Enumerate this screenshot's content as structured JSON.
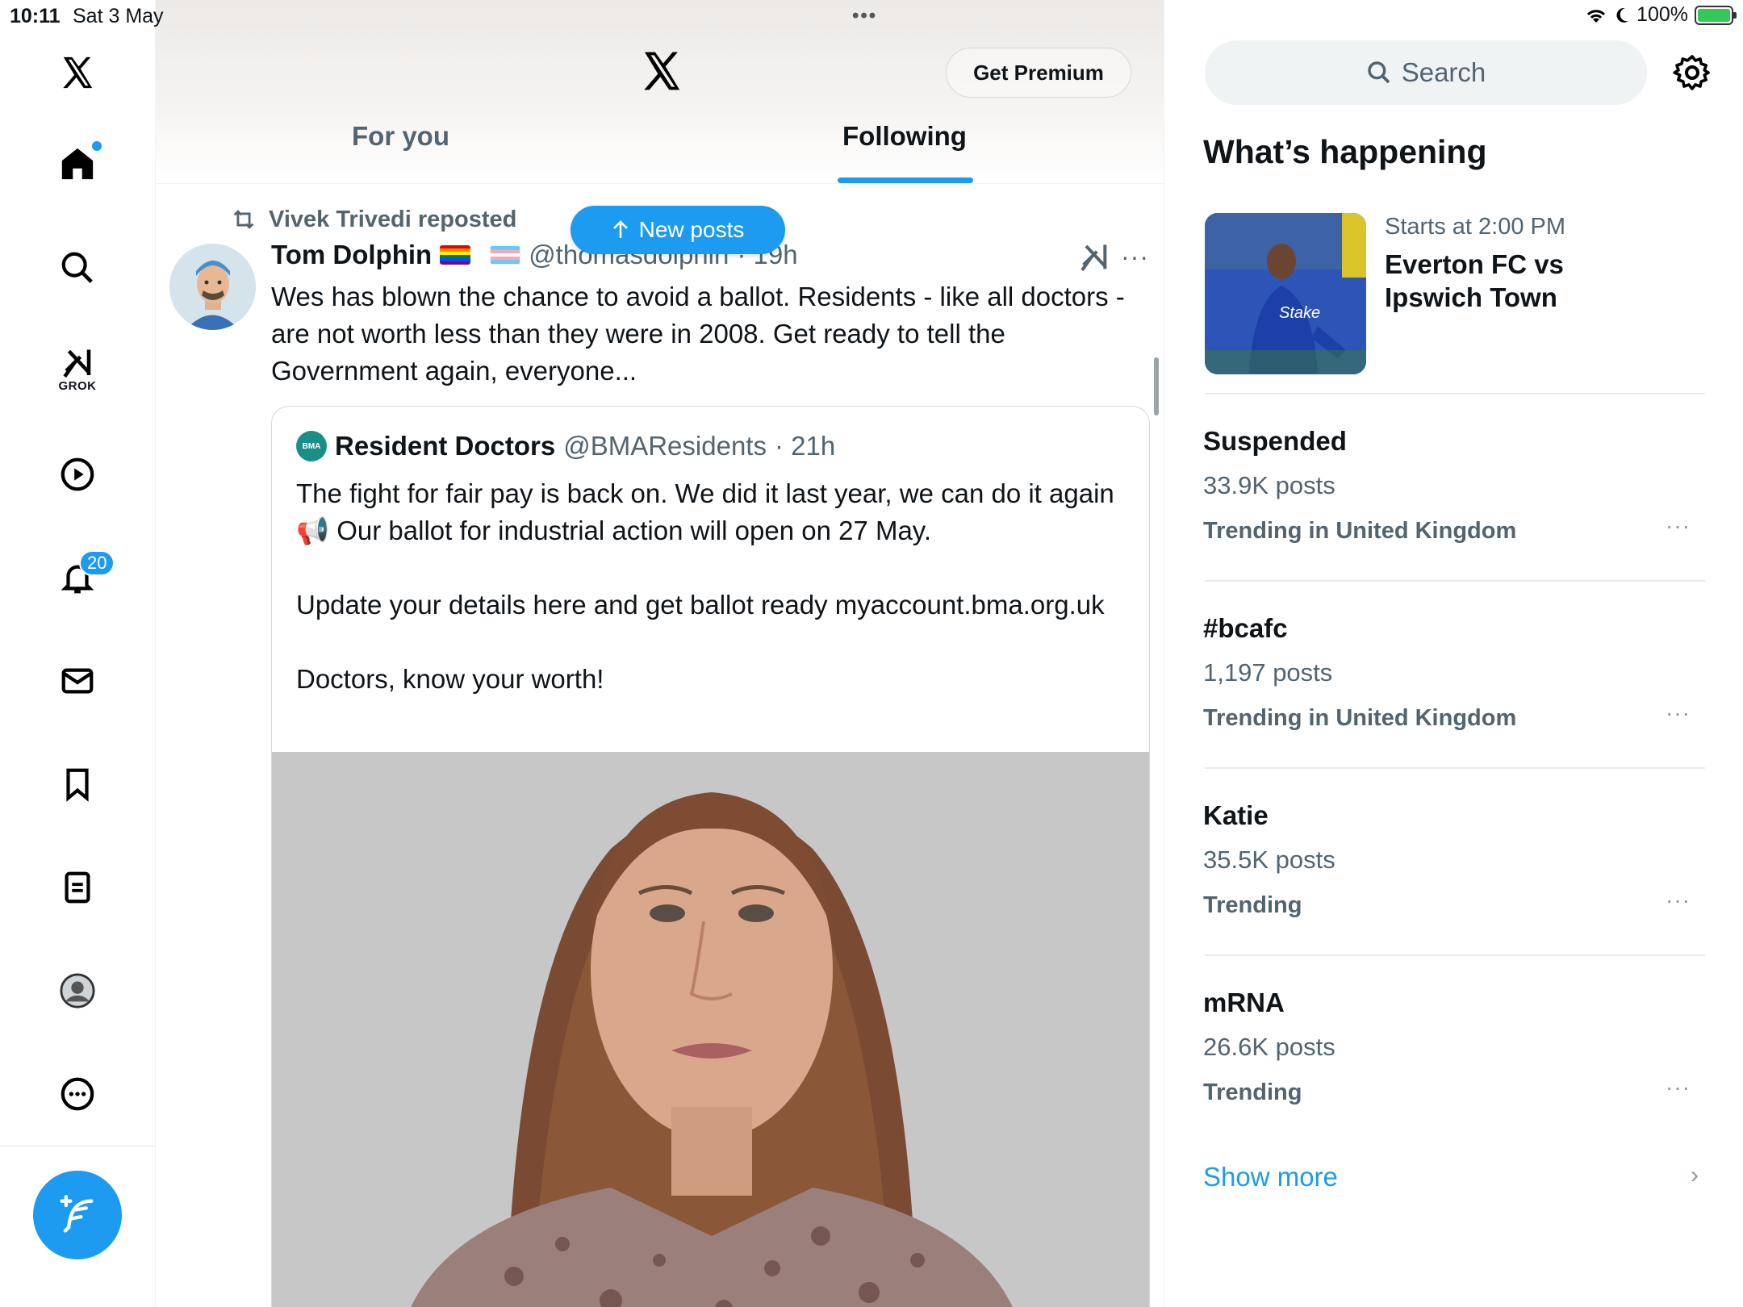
{
  "status_bar": {
    "time": "10:11",
    "date": "Sat 3 May",
    "dots": "•••",
    "battery": "100%"
  },
  "nav": {
    "grok_label": "GROK",
    "notifications_badge": "20",
    "items": [
      "x-logo",
      "home-icon",
      "search-icon",
      "grok-icon",
      "video-icon",
      "bell-icon",
      "mail-icon",
      "bookmark-icon",
      "list-icon",
      "profile-icon",
      "more-icon"
    ]
  },
  "header": {
    "premium_label": "Get Premium",
    "tabs": [
      {
        "label": "For you",
        "active": false
      },
      {
        "label": "Following",
        "active": true
      }
    ],
    "new_posts_label": "New posts"
  },
  "post": {
    "repost_by": "Vivek Trivedi reposted",
    "author_name": "Tom Dolphin",
    "author_handle": "@thomasdolphin",
    "time": "· 19h",
    "more": "···",
    "text": "Wes has blown the chance to avoid a ballot. Residents - like all doctors - are not worth less than they were in 2008. Get ready to tell the Government again, everyone...",
    "quote": {
      "logo_text": "BMA",
      "author_name": "Resident Doctors",
      "author_handle": "@BMAResidents",
      "time": "· 21h",
      "text": "The fight for fair pay is back on. We did it last year, we can do it again 📢 Our ballot for industrial action will open on 27 May.\n\nUpdate your details here and get ballot ready myaccount.bma.org.uk\n\nDoctors, know your worth!"
    }
  },
  "sidebar": {
    "search_placeholder": "Search",
    "title": "What’s happening",
    "event": {
      "time": "Starts at 2:00 PM",
      "title": "Everton FC vs Ipswich Town",
      "image_text": "Stake"
    },
    "trends": [
      {
        "name": "Suspended",
        "count": "33.9K posts",
        "context": "Trending in United Kingdom",
        "more": "···"
      },
      {
        "name": "#bcafc",
        "count": "1,197 posts",
        "context": "Trending in United Kingdom",
        "more": "···"
      },
      {
        "name": "Katie",
        "count": "35.5K posts",
        "context": "Trending",
        "more": "···"
      },
      {
        "name": "mRNA",
        "count": "26.6K posts",
        "context": "Trending",
        "more": "···"
      }
    ],
    "show_more": "Show more",
    "chevron": "›"
  },
  "colors": {
    "accent": "#1d9bf0",
    "text": "#0f1419",
    "secondary": "#536471"
  }
}
